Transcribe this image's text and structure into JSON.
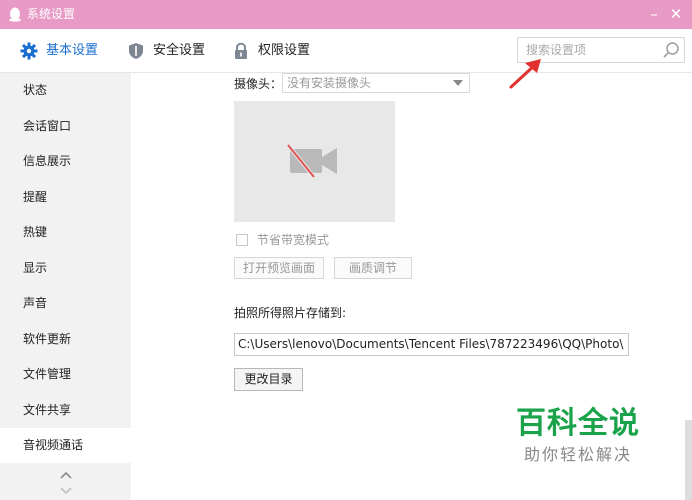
{
  "window": {
    "title": "系统设置",
    "minimize_glyph": "–",
    "close_glyph": "✕"
  },
  "tabs": [
    {
      "label": "基本设置",
      "icon": "gear-icon",
      "active": true
    },
    {
      "label": "安全设置",
      "icon": "shield-icon",
      "active": false
    },
    {
      "label": "权限设置",
      "icon": "lock-icon",
      "active": false
    }
  ],
  "search": {
    "placeholder": "搜索设置项",
    "value": ""
  },
  "sidebar": {
    "items": [
      {
        "label": "状态"
      },
      {
        "label": "会话窗口"
      },
      {
        "label": "信息展示"
      },
      {
        "label": "提醒"
      },
      {
        "label": "热键"
      },
      {
        "label": "显示"
      },
      {
        "label": "声音"
      },
      {
        "label": "软件更新"
      },
      {
        "label": "文件管理"
      },
      {
        "label": "文件共享"
      },
      {
        "label": "音视频通话"
      }
    ],
    "active_item": "音视频通话"
  },
  "camera": {
    "label": "摄像头：",
    "selected": "没有安装摄像头",
    "preview_icon": "camera-off-icon"
  },
  "bandwidth": {
    "label": "节省带宽模式",
    "checked": false
  },
  "buttons": {
    "preview": "打开预览画面",
    "quality": "画质调节",
    "change_dir": "更改目录"
  },
  "photo": {
    "save_label": "拍照所得照片存储到:",
    "path": "C:\\Users\\lenovo\\Documents\\Tencent Files\\787223496\\QQ\\Photo\\"
  },
  "watermark": {
    "main": "百科全说",
    "sub": "助你轻松解决"
  },
  "colors": {
    "titlebar": "#e89ac6",
    "accent": "#1b6fcf",
    "sidebar_bg": "#f2f2f2",
    "annotation": "#e03030",
    "watermark_green": "#1aa34a"
  }
}
